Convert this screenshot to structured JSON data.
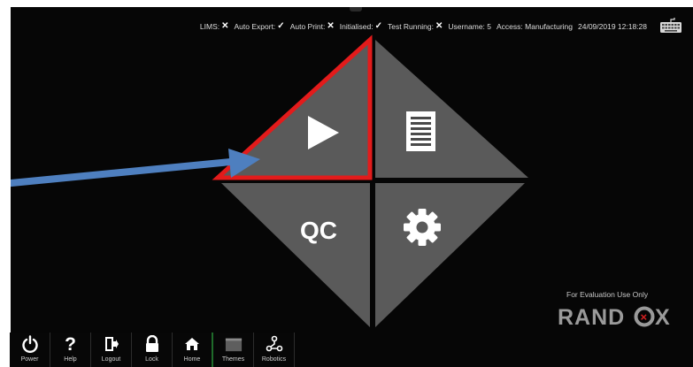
{
  "status": {
    "lims_label": "LIMS:",
    "lims_icon": "cross-icon",
    "auto_export_label": "Auto Export:",
    "auto_export_icon": "check-icon",
    "auto_print_label": "Auto Print:",
    "auto_print_icon": "cross-icon",
    "initialised_label": "Initialised:",
    "initialised_icon": "check-icon",
    "test_running_label": "Test Running:",
    "test_running_icon": "cross-icon",
    "username": "Username: 5",
    "access": "Access: Manufacturing",
    "datetime": "24/09/2019 12:18:28"
  },
  "tiles": {
    "top_left_icon": "play-icon",
    "top_right_icon": "document-icon",
    "bottom_left_label": "QC",
    "bottom_right_icon": "gear-icon"
  },
  "eval_text": "For Evaluation Use Only",
  "brand": {
    "text": "RANDOX"
  },
  "toolbar": {
    "power": "Power",
    "help": "Help",
    "logout": "Logout",
    "lock": "Lock",
    "home": "Home",
    "themes": "Themes",
    "robotics": "Robotics"
  },
  "colors": {
    "screen_bg": "#060606",
    "tile": "#5a5a5a",
    "highlight": "#e31b1b",
    "arrow": "#4e7fbf",
    "brand_o": "#d62020"
  }
}
